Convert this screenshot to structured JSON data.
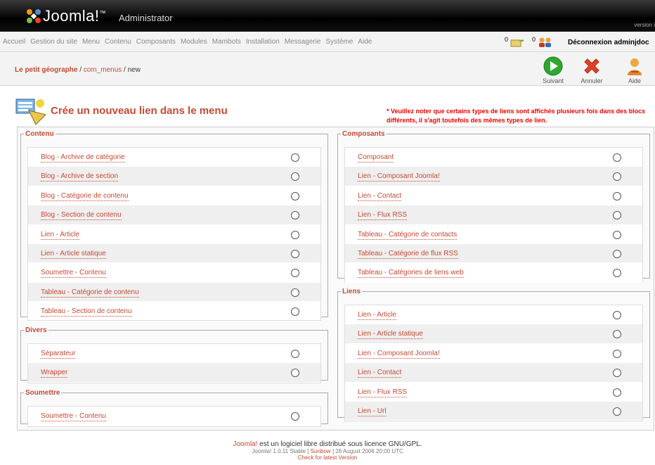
{
  "header": {
    "logo_text": "Joomla!",
    "logo_tm": "™",
    "admin_text": "Administrator",
    "version_text": "version i"
  },
  "menu": {
    "items": [
      "Accueil",
      "Gestion du site",
      "Menu",
      "Contenu",
      "Composants",
      "Modules",
      "Mambots",
      "Installation",
      "Messagerie",
      "Système",
      "Aide"
    ],
    "messages_count": "0",
    "users_count": "0",
    "logout_label": "Déconnexion adminjdoc"
  },
  "path": {
    "site": "Le petit géographe",
    "sep1": " / ",
    "component": "com_menus",
    "sep2": " / ",
    "task": "new"
  },
  "toolbar": {
    "next_label": "Suivant",
    "cancel_label": "Annuler",
    "help_label": "Aide"
  },
  "page": {
    "title": "Crée un nouveau lien dans le menu",
    "note": "* Veuillez noter que certains types de liens sont affichés plusieurs fois dans des blocs différents, il s'agit toutefois des mêmes types de lien."
  },
  "sections": {
    "contenu": {
      "legend": "Contenu",
      "items": [
        "Blog - Archive de catégorie",
        "Blog - Archive de section",
        "Blog - Catégorie de contenu",
        "Blog - Section de contenu",
        "Lien - Article",
        "Lien - Article statique",
        "Soumettre - Contenu",
        "Tableau - Catégorie de contenu",
        "Tableau - Section de contenu"
      ]
    },
    "divers": {
      "legend": "Divers",
      "items": [
        "Séparateur",
        "Wrapper"
      ]
    },
    "soumettre": {
      "legend": "Soumettre",
      "items": [
        "Soumettre - Contenu"
      ]
    },
    "composants": {
      "legend": "Composants",
      "items": [
        "Composant",
        "Lien - Composant Joomla!",
        "Lien - Contact",
        "Lien - Flux RSS",
        "Tableau - Catégorie de contacts",
        "Tableau - Catégorie de flux RSS",
        "Tableau - Catégories de liens web"
      ]
    },
    "liens": {
      "legend": "Liens",
      "items": [
        "Lien - Article",
        "Lien - Article statique",
        "Lien - Composant Joomla!",
        "Lien - Contact",
        "Lien - Flux RSS",
        "Lien - Url"
      ]
    }
  },
  "footer": {
    "joomla": "Joomla!",
    "line1_rest": " est un logiciel libre distribué sous licence GNU/GPL.",
    "line2_a": "Joomla! 1.0.11 Stable [ ",
    "line2_codename": "Sunbow",
    "line2_b": " ] 28 August 2006 20:00 UTC",
    "line3": "Check for latest Version"
  },
  "colors": {
    "accent": "#c64934",
    "note_red": "#ee0000",
    "header_bg": "#000000"
  }
}
